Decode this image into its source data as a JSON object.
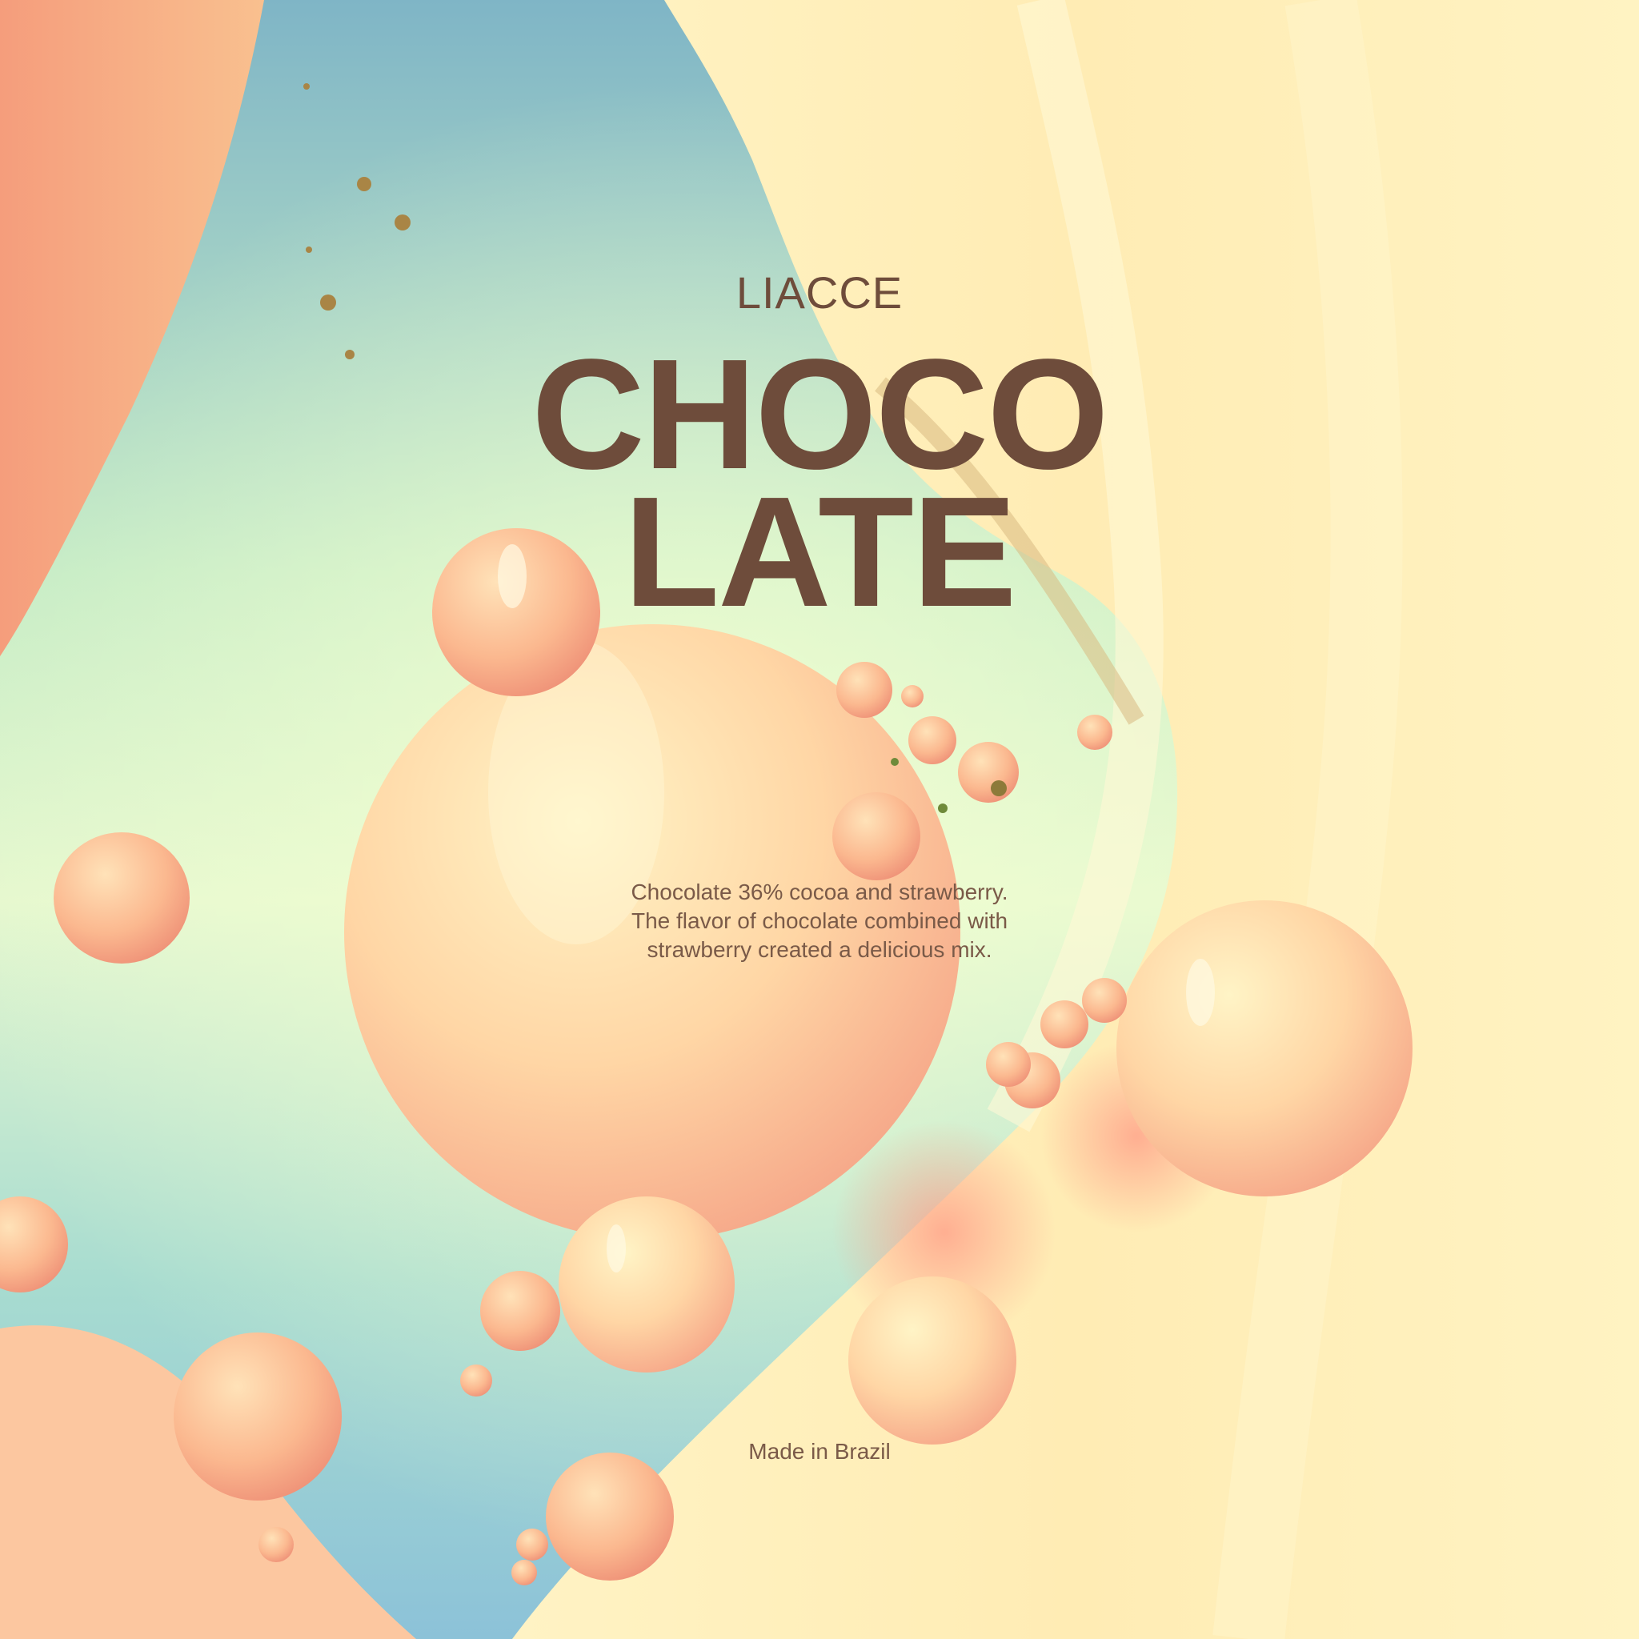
{
  "brand": "LIACCE",
  "headline": {
    "line1": "CHOCO",
    "line2": "LATE"
  },
  "description": {
    "line1": "Chocolate 36% cocoa and strawberry.",
    "line2": "The flavor of chocolate combined with",
    "line3": "strawberry created a delicious mix."
  },
  "origin": "Made in Brazil",
  "colors": {
    "text_brown": "#6e4c3b",
    "peach": "#f8b98f",
    "cream": "#fff1be",
    "mint": "#bfe9d2",
    "sky": "#8cc5d6",
    "coral": "#f4a27e"
  }
}
